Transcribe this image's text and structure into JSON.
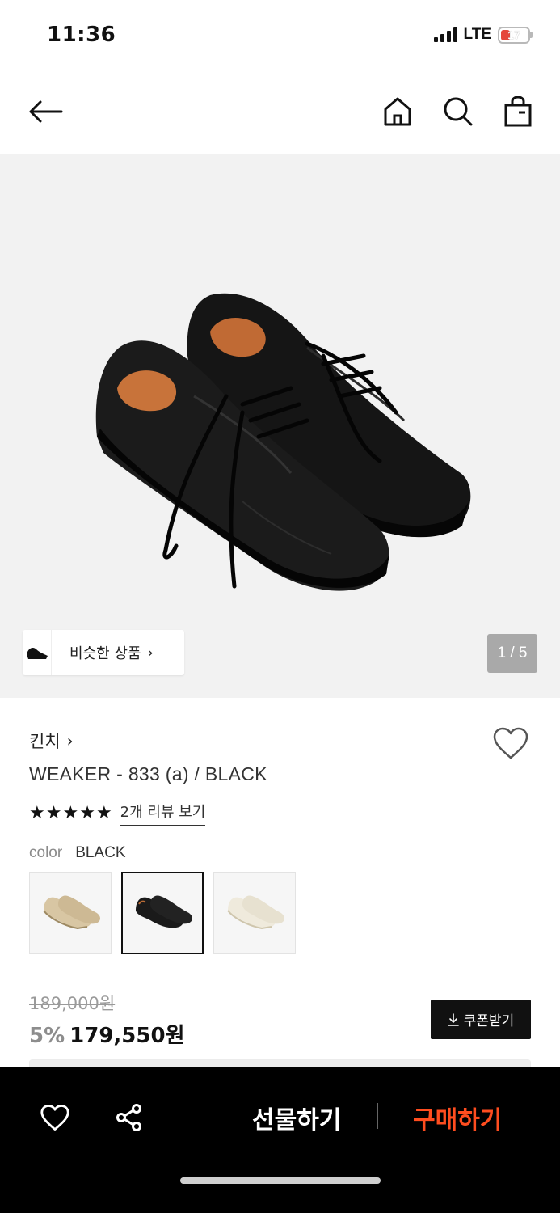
{
  "status_bar": {
    "time": "11:36",
    "network": "LTE",
    "battery": "17"
  },
  "nav": {
    "icons": [
      "back-arrow-icon",
      "home-icon",
      "search-icon",
      "shopping-bag-icon"
    ]
  },
  "hero": {
    "similar_label": "비슷한 상품",
    "page_indicator": "1 / 5"
  },
  "product": {
    "brand": "킨치",
    "name": "WEAKER - 833 (a) / BLACK",
    "rating_stars": 5,
    "review_link": "2개 리뷰 보기",
    "color_label": "color",
    "color_value": "BLACK",
    "swatches": [
      {
        "color": "beige",
        "selected": false
      },
      {
        "color": "black",
        "selected": true
      },
      {
        "color": "cream",
        "selected": false
      }
    ]
  },
  "price": {
    "original": "189,000원",
    "discount": "5%",
    "final": "179,550원",
    "coupon_label": "쿠폰받기"
  },
  "bottom_bar": {
    "gift_label": "선물하기",
    "buy_label": "구매하기"
  },
  "colors": {
    "accent": "#ff4d1f",
    "bottom_bar_bg": "#000000",
    "hero_bg": "#f2f2f2"
  }
}
